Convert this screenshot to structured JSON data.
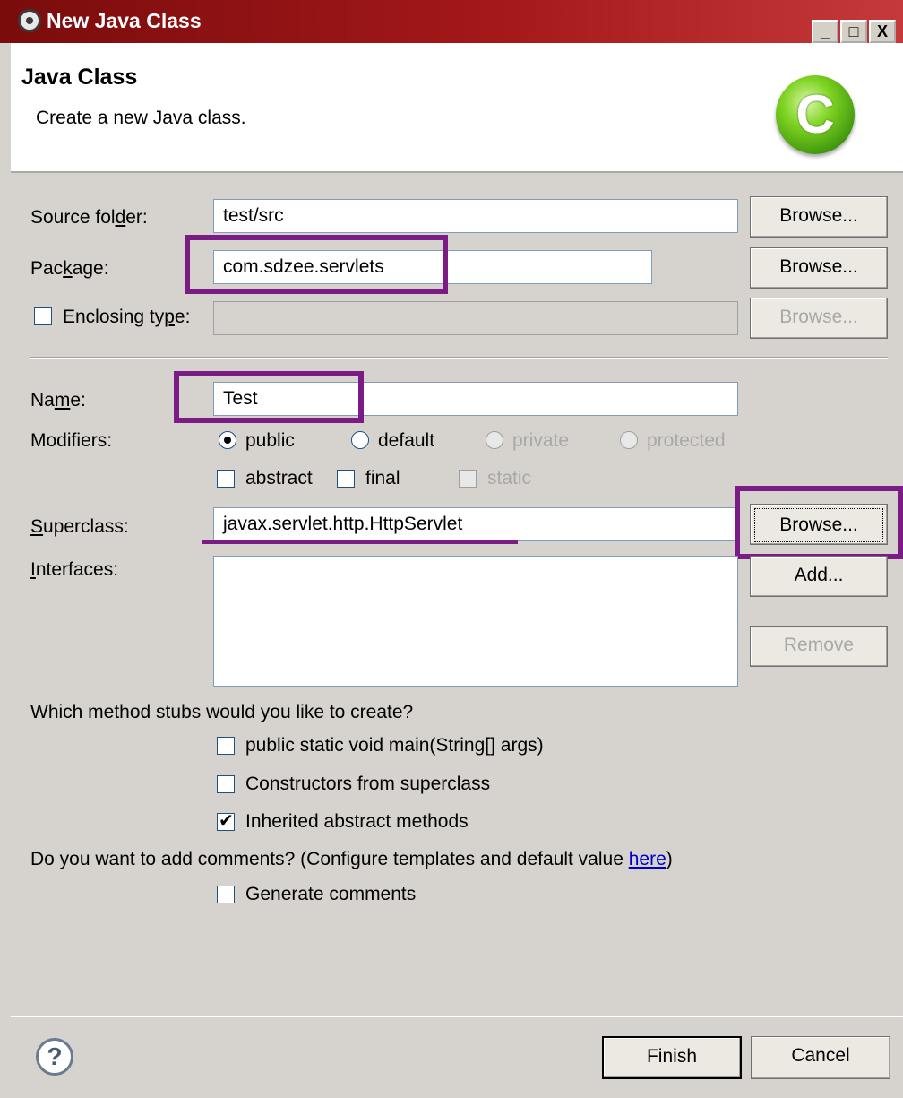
{
  "window": {
    "title": "New Java Class",
    "minimize": "_",
    "maximize": "□",
    "close": "X"
  },
  "header": {
    "title": "Java Class",
    "description": "Create a new Java class.",
    "logo_letter": "C"
  },
  "source_folder": {
    "label_pre": "Source fol",
    "label_ul": "d",
    "label_post": "er:",
    "value": "test/src",
    "browse": "Browse..."
  },
  "package": {
    "label_pre": "Pac",
    "label_ul": "k",
    "label_post": "age:",
    "value": "com.sdzee.servlets",
    "browse": "Browse..."
  },
  "enclosing": {
    "label_pre": "Enclosing ty",
    "label_ul": "p",
    "label_post": "e:",
    "value": "",
    "browse": "Browse..."
  },
  "name": {
    "label_pre": "Na",
    "label_ul": "m",
    "label_post": "e:",
    "value": "Test"
  },
  "modifiers": {
    "label": "Modifiers:",
    "public": "public",
    "default": "default",
    "private": "private",
    "protected": "protected",
    "abstract": "abstract",
    "final": "final",
    "static": "static"
  },
  "superclass": {
    "label_ul": "S",
    "label_post": "uperclass:",
    "value": "javax.servlet.http.HttpServlet",
    "browse": "Browse..."
  },
  "interfaces": {
    "label_ul": "I",
    "label_post": "nterfaces:",
    "add": "Add...",
    "remove": "Remove"
  },
  "stubs": {
    "question": "Which method stubs would you like to create?",
    "main": "public static void main(String[] args)",
    "constructors": "Constructors from superclass",
    "inherited": "Inherited abstract methods"
  },
  "comments": {
    "question_pre": "Do you want to add comments? (Configure templates and default value ",
    "link": "here",
    "question_post": ")",
    "generate": "Generate comments"
  },
  "footer": {
    "help": "?",
    "finish": "Finish",
    "cancel": "Cancel"
  }
}
